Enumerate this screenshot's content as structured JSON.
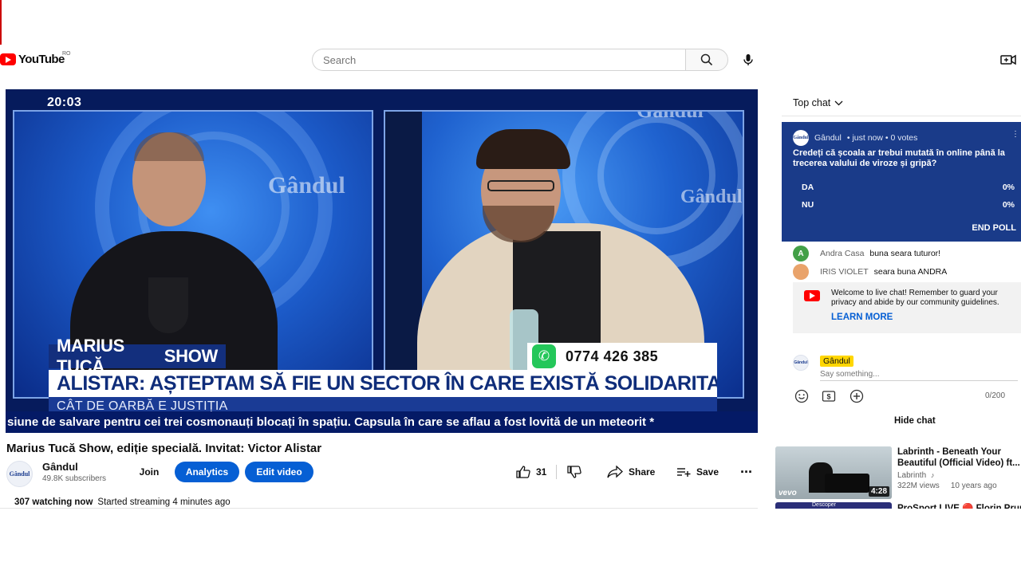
{
  "header": {
    "logo_text": "YouTube",
    "country_code": "RO",
    "search_placeholder": "Search"
  },
  "video": {
    "timecode": "20:03",
    "channel_watermark": "Gândul",
    "show_name": "MARIUS TUCĂ",
    "show_suffix": "SHOW",
    "phone": "0774 426 385",
    "headline": "ALISTAR: AȘTEPTAM SĂ FIE UN SECTOR ÎN CARE EXISTĂ SOLIDARITATE DE CAZ",
    "subheadline": "CÂT DE OARBĂ E JUSTIȚIA",
    "ticker": "siune de salvare pentru cei trei cosmonauți blocați în spațiu. Capsula în care se aflau a fost lovită de un meteorit *"
  },
  "info": {
    "title": "Marius Tucă Show, ediție specială. Invitat: Victor Alistar",
    "channel_name": "Gândul",
    "subscribers": "49.8K subscribers",
    "join_label": "Join",
    "analytics_label": "Analytics",
    "edit_label": "Edit video",
    "like_count": "31",
    "share_label": "Share",
    "save_label": "Save",
    "watching": "307 watching now",
    "started": "Started streaming 4 minutes ago"
  },
  "chat": {
    "mode_label": "Top chat",
    "poll": {
      "author": "Gândul",
      "meta": "• just now • 0 votes",
      "question": "Credeți că școala ar trebui mutată în online până la trecerea valului de viroze și gripă?",
      "options": [
        {
          "label": "DA",
          "pct": "0%"
        },
        {
          "label": "NU",
          "pct": "0%"
        }
      ],
      "end_label": "END POLL"
    },
    "messages": [
      {
        "author": "Andra Casa",
        "text": "buna seara tuturor!",
        "initial": "A",
        "color": "#43a047"
      },
      {
        "author": "IRIS VIOLET",
        "text": "seara buna ANDRA",
        "initial": "",
        "color": "#e9a36b"
      }
    ],
    "notice_text": "Welcome to live chat! Remember to guard your privacy and abide by our community guidelines.",
    "learn_more": "LEARN MORE",
    "input_author": "Gândul",
    "input_placeholder": "Say something...",
    "char_count": "0/200",
    "hide_chat": "Hide chat"
  },
  "recommendations": [
    {
      "title": "Labrinth - Beneath Your Beautiful (Official Video) ft...",
      "channel": "Labrinth",
      "views": "322M views",
      "age": "10 years ago",
      "duration": "4:28",
      "badge": "vevo"
    },
    {
      "title": "ProSport LIVE 🔴 Florin Prun",
      "thumb_text": "Descoper"
    }
  ],
  "colors": {
    "brand_red": "#ff0000",
    "accent_blue": "#065fd4",
    "poll_bg": "#1a3b89",
    "ticker_bg": "#041a66"
  }
}
